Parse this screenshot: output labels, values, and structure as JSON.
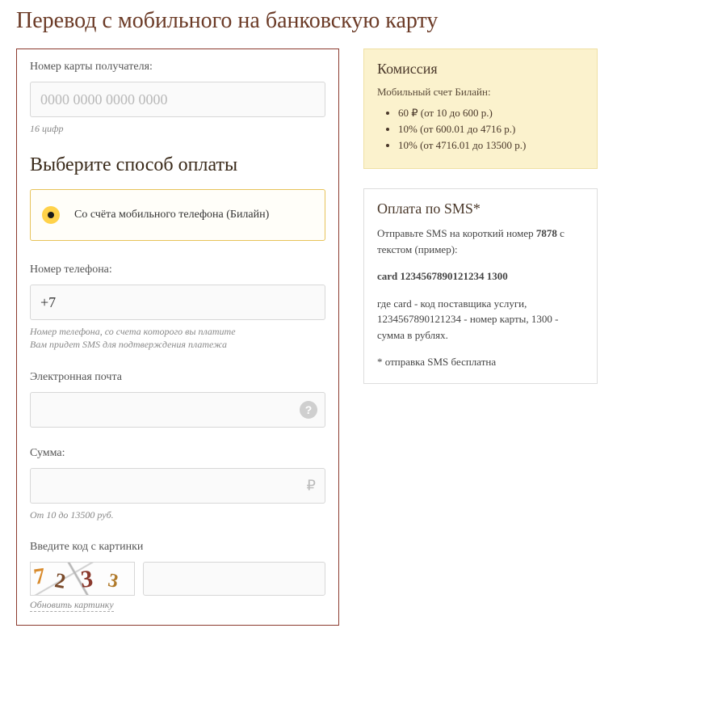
{
  "page": {
    "title": "Перевод с мобильного на банковскую карту"
  },
  "form": {
    "card": {
      "label": "Номер карты получателя:",
      "placeholder": "0000 0000 0000 0000",
      "hint": "16 цифр"
    },
    "payment_method": {
      "section_title": "Выберите способ оплаты",
      "option_label": "Со счёта мобильного телефона (Билайн)"
    },
    "phone": {
      "label": "Номер телефона:",
      "value": "+7",
      "hint": "Номер телефона, со счета которого вы платите\nВам придет SMS для подтверждения платежа"
    },
    "email": {
      "label": "Электронная почта",
      "help": "?"
    },
    "amount": {
      "label": "Сумма:",
      "currency": "₽",
      "hint": "От 10 до 13500 руб."
    },
    "captcha": {
      "label": "Введите код с картинки",
      "glyphs": [
        "7",
        "2",
        "3",
        "3"
      ],
      "refresh": "Обновить картинку"
    }
  },
  "commission": {
    "title": "Комиссия",
    "subtitle": "Мобильный счет Билайн:",
    "items": [
      "60 ₽ (от 10 до 600 р.)",
      "10% (от 600.01 до 4716 р.)",
      "10% (от 4716.01 до 13500 р.)"
    ]
  },
  "sms": {
    "title": "Оплата по SMS*",
    "intro_prefix": "Отправьте SMS на короткий номер ",
    "intro_number": "7878",
    "intro_suffix": " с текстом (пример):",
    "example": "card 1234567890121234 1300",
    "explain": "где card - код поставщика услуги, 1234567890121234 - номер карты, 1300 - сумма в рублях.",
    "note": "* отправка SMS бесплатна"
  }
}
